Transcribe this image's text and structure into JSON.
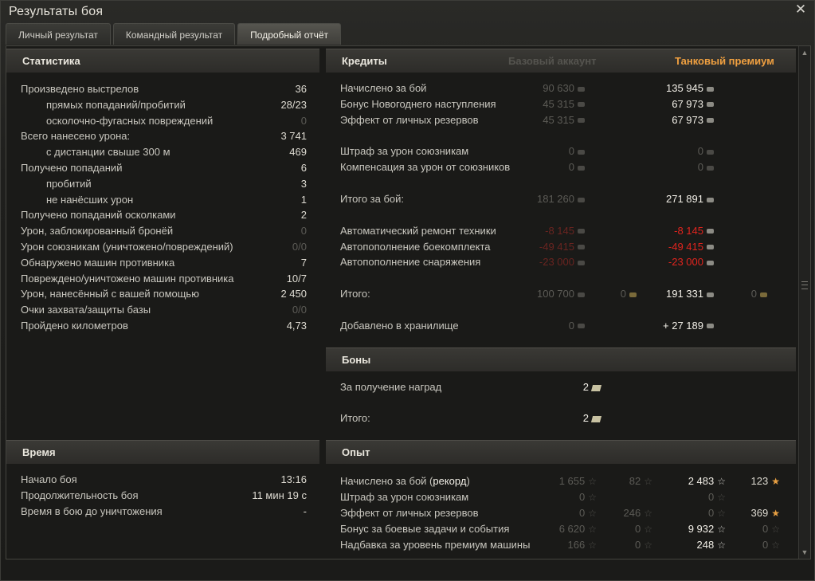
{
  "window": {
    "title": "Результаты боя"
  },
  "tabs": [
    "Личный результат",
    "Командный результат",
    "Подробный отчёт"
  ],
  "stats": {
    "title": "Статистика",
    "rows": [
      {
        "label": "Произведено выстрелов",
        "value": "36",
        "indent": false,
        "dim": false
      },
      {
        "label": "прямых попаданий/пробитий",
        "value": "28/23",
        "indent": true,
        "dim": false
      },
      {
        "label": "осколочно-фугасных повреждений",
        "value": "0",
        "indent": true,
        "dim": true
      },
      {
        "label": "Всего нанесено урона:",
        "value": "3 741",
        "indent": false,
        "dim": false
      },
      {
        "label": "с дистанции свыше 300 м",
        "value": "469",
        "indent": true,
        "dim": false
      },
      {
        "label": "Получено попаданий",
        "value": "6",
        "indent": false,
        "dim": false
      },
      {
        "label": "пробитий",
        "value": "3",
        "indent": true,
        "dim": false
      },
      {
        "label": "не нанёсших урон",
        "value": "1",
        "indent": true,
        "dim": false
      },
      {
        "label": "Получено попаданий осколками",
        "value": "2",
        "indent": false,
        "dim": false
      },
      {
        "label": "Урон, заблокированный бронёй",
        "value": "0",
        "indent": false,
        "dim": true
      },
      {
        "label": "Урон союзникам (уничтожено/повреждений)",
        "value": "0/0",
        "indent": false,
        "dim": true
      },
      {
        "label": "Обнаружено машин противника",
        "value": "7",
        "indent": false,
        "dim": false
      },
      {
        "label": "Повреждено/уничтожено машин противника",
        "value": "10/7",
        "indent": false,
        "dim": false
      },
      {
        "label": "Урон, нанесённый с вашей помощью",
        "value": "2 450",
        "indent": false,
        "dim": false
      },
      {
        "label": "Очки захвата/защиты базы",
        "value": "0/0",
        "indent": false,
        "dim": true
      },
      {
        "label": "Пройдено километров",
        "value": "4,73",
        "indent": false,
        "dim": false
      }
    ]
  },
  "time": {
    "title": "Время",
    "rows": [
      {
        "label": "Начало боя",
        "value": "13:16"
      },
      {
        "label": "Продолжительность боя",
        "value": "11 мин 19 с"
      },
      {
        "label": "Время в бою до уничтожения",
        "value": "-"
      }
    ]
  },
  "credits": {
    "title": "Кредиты",
    "col_base": "Базовый аккаунт",
    "col_premium": "Танковый премиум",
    "rows": [
      {
        "label": "Начислено за бой",
        "base": "90 630",
        "prem": "135 945",
        "y": 0
      },
      {
        "label": "Бонус Новогоднего наступления",
        "base": "45 315",
        "prem": "67 973",
        "y": 1
      },
      {
        "label": "Эффект от личных резервов",
        "base": "45 315",
        "prem": "67 973",
        "y": 2
      },
      {
        "label": "Штраф за урон союзникам",
        "base": "0",
        "prem": "0",
        "y": 4,
        "premdim": true
      },
      {
        "label": "Компенсация за урон от союзников",
        "base": "0",
        "prem": "0",
        "y": 5,
        "premdim": true
      },
      {
        "label": "Итого за бой:",
        "base": "181 260",
        "prem": "271 891",
        "y": 7
      },
      {
        "label": "Автоматический ремонт техники",
        "base": "-8 145",
        "prem": "-8 145",
        "y": 9,
        "red": true
      },
      {
        "label": "Автопополнение боекомплекта",
        "base": "-49 415",
        "prem": "-49 415",
        "y": 10,
        "red": true
      },
      {
        "label": "Автопополнение снаряжения",
        "base": "-23 000",
        "prem": "-23 000",
        "y": 11,
        "red": true
      },
      {
        "label": "Итого:",
        "base": "100 700",
        "base_gold": "0",
        "prem": "191 331",
        "prem_gold": "0",
        "y": 13
      },
      {
        "label": "Добавлено в хранилище",
        "base": "0",
        "prem": "+ 27 189",
        "y": 15
      }
    ]
  },
  "bonds": {
    "title": "Боны",
    "rows": [
      {
        "label": "За получение наград",
        "value": "2"
      },
      {
        "label": "Итого:",
        "value": "2"
      }
    ]
  },
  "xp": {
    "title": "Опыт",
    "rows": [
      {
        "label": "Начислено за бой (",
        "label_bold": "рекорд",
        "label_end": ")",
        "base": "1 655",
        "base_free": "82",
        "prem": "2 483",
        "prem_free": "123",
        "prem_free_gold": true
      },
      {
        "label": "Штраф за урон союзникам",
        "base": "0",
        "base_free": "",
        "prem": "0",
        "prem_free": "",
        "premdim": true
      },
      {
        "label": "Эффект от личных резервов",
        "base": "0",
        "base_free": "246",
        "prem": "0",
        "prem_free": "369",
        "premdim": true,
        "prem_free_gold": true
      },
      {
        "label": "Бонус за боевые задачи и события",
        "base": "6 620",
        "base_free": "0",
        "prem": "9 932",
        "prem_free": "0"
      },
      {
        "label": "Надбавка за уровень премиум машины",
        "base": "166",
        "base_free": "0",
        "prem": "248",
        "prem_free": "0"
      }
    ]
  },
  "colors": {
    "premium_header": "#f0a040",
    "negative": "#e0241e",
    "accent_star": "#e8a043"
  }
}
